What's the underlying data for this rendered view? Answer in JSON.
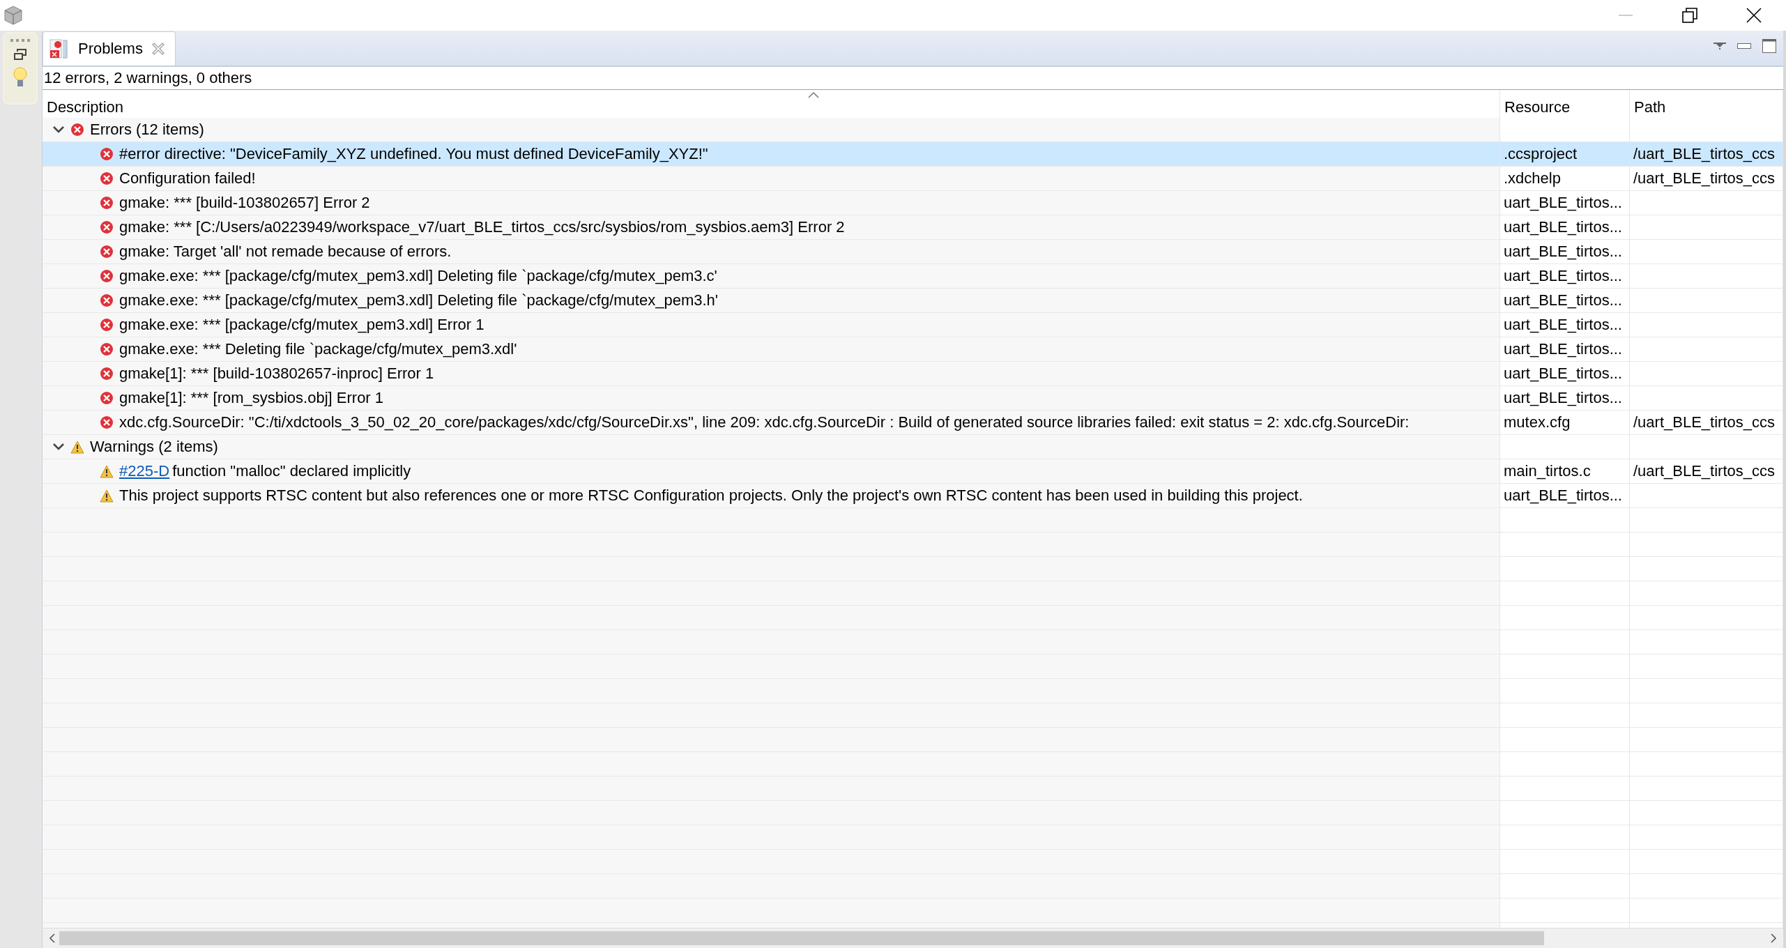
{
  "view_tab": {
    "label": "Problems",
    "selected": true
  },
  "summary": "12 errors, 2 warnings, 0 others",
  "columns": [
    "Description",
    "Resource",
    "Path"
  ],
  "groups": [
    {
      "kind": "error",
      "label": "Errors (12 items)",
      "expanded": true,
      "children": [
        {
          "description": "#error directive: \"DeviceFamily_XYZ undefined. You must defined DeviceFamily_XYZ!\"",
          "resource": ".ccsproject",
          "path": "/uart_BLE_tirtos_ccs",
          "selected": true
        },
        {
          "description": "Configuration failed!",
          "resource": ".xdchelp",
          "path": "/uart_BLE_tirtos_ccs",
          "selected": false
        },
        {
          "description": "gmake: *** [build-103802657] Error 2",
          "resource": "uart_BLE_tirtos...",
          "selected": false
        },
        {
          "description": "gmake: *** [C:/Users/a0223949/workspace_v7/uart_BLE_tirtos_ccs/src/sysbios/rom_sysbios.aem3] Error 2",
          "resource": "uart_BLE_tirtos...",
          "selected": false
        },
        {
          "description": "gmake: Target 'all' not remade because of errors.",
          "resource": "uart_BLE_tirtos...",
          "selected": false
        },
        {
          "description": "gmake.exe: *** [package/cfg/mutex_pem3.xdl] Deleting file `package/cfg/mutex_pem3.c'",
          "resource": "uart_BLE_tirtos...",
          "selected": false
        },
        {
          "description": "gmake.exe: *** [package/cfg/mutex_pem3.xdl] Deleting file `package/cfg/mutex_pem3.h'",
          "resource": "uart_BLE_tirtos...",
          "selected": false
        },
        {
          "description": "gmake.exe: *** [package/cfg/mutex_pem3.xdl] Error 1",
          "resource": "uart_BLE_tirtos...",
          "selected": false
        },
        {
          "description": "gmake.exe: *** Deleting file `package/cfg/mutex_pem3.xdl'",
          "resource": "uart_BLE_tirtos...",
          "selected": false
        },
        {
          "description": "gmake[1]: *** [build-103802657-inproc] Error 1",
          "resource": "uart_BLE_tirtos...",
          "selected": false
        },
        {
          "description": "gmake[1]: *** [rom_sysbios.obj] Error 1",
          "resource": "uart_BLE_tirtos...",
          "selected": false
        },
        {
          "description": "xdc.cfg.SourceDir: \"C:/ti/xdctools_3_50_02_20_core/packages/xdc/cfg/SourceDir.xs\", line 209: xdc.cfg.SourceDir : Build of generated source libraries failed: exit status = 2: xdc.cfg.SourceDir:",
          "resource": "mutex.cfg",
          "path": "/uart_BLE_tirtos_ccs",
          "selected": false
        }
      ]
    },
    {
      "kind": "warning",
      "label": "Warnings (2 items)",
      "expanded": true,
      "children": [
        {
          "link": "#225-D",
          "description": "function \"malloc\" declared implicitly",
          "resource": "main_tirtos.c",
          "path": "/uart_BLE_tirtos_ccs",
          "selected": false
        },
        {
          "description": "This project supports RTSC content but also references one or more RTSC Configuration projects. Only the project's own RTSC content has been used in building this project.",
          "resource": "uart_BLE_tirtos...",
          "selected": false
        }
      ]
    }
  ]
}
